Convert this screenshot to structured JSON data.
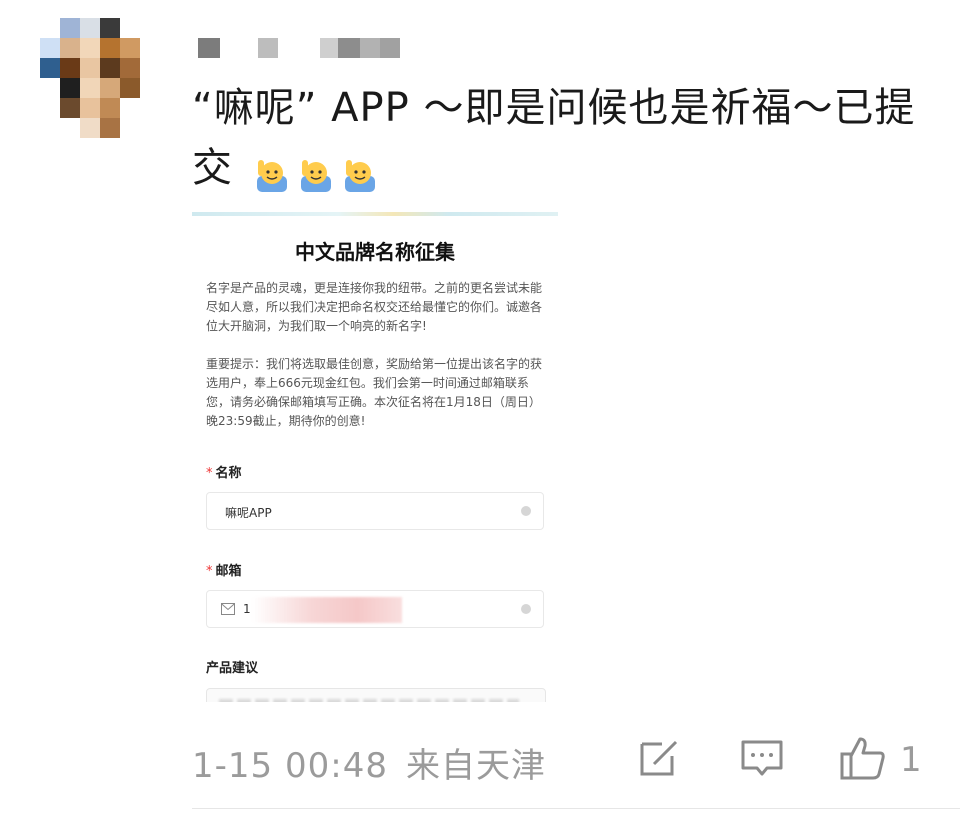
{
  "post": {
    "author_name": "",
    "text_main": "“嘛呢” APP ～即是问候也是祈福～已提交",
    "emoji": [
      "raising-hand-emoji",
      "raising-hand-emoji",
      "raising-hand-emoji"
    ]
  },
  "form": {
    "title": "中文品牌名称征集",
    "intro": "名字是产品的灵魂，更是连接你我的纽带。之前的更名尝试未能尽如人意，所以我们决定把命名权交还给最懂它的你们。诚邀各位大开脑洞，为我们取一个响亮的新名字!",
    "notice": "重要提示：我们将选取最佳创意，奖励给第一位提出该名字的获选用户，奉上666元现金红包。我们会第一时间通过邮箱联系您，请务必确保邮箱填写正确。本次征名将在1月18日（周日）晚23:59截止，期待你的创意!",
    "required_mark": "*",
    "name_label": "名称",
    "name_value": "嘛呢APP",
    "email_label": "邮箱",
    "email_value": "1",
    "suggestion_label": "产品建议"
  },
  "footer": {
    "timestamp": "1-15 00:48",
    "location": "来自天津",
    "like_count": "1"
  },
  "colors": {
    "meta_gray": "#9b9b9b",
    "required_red": "#e33333",
    "text_dark": "#1a1a1a"
  }
}
